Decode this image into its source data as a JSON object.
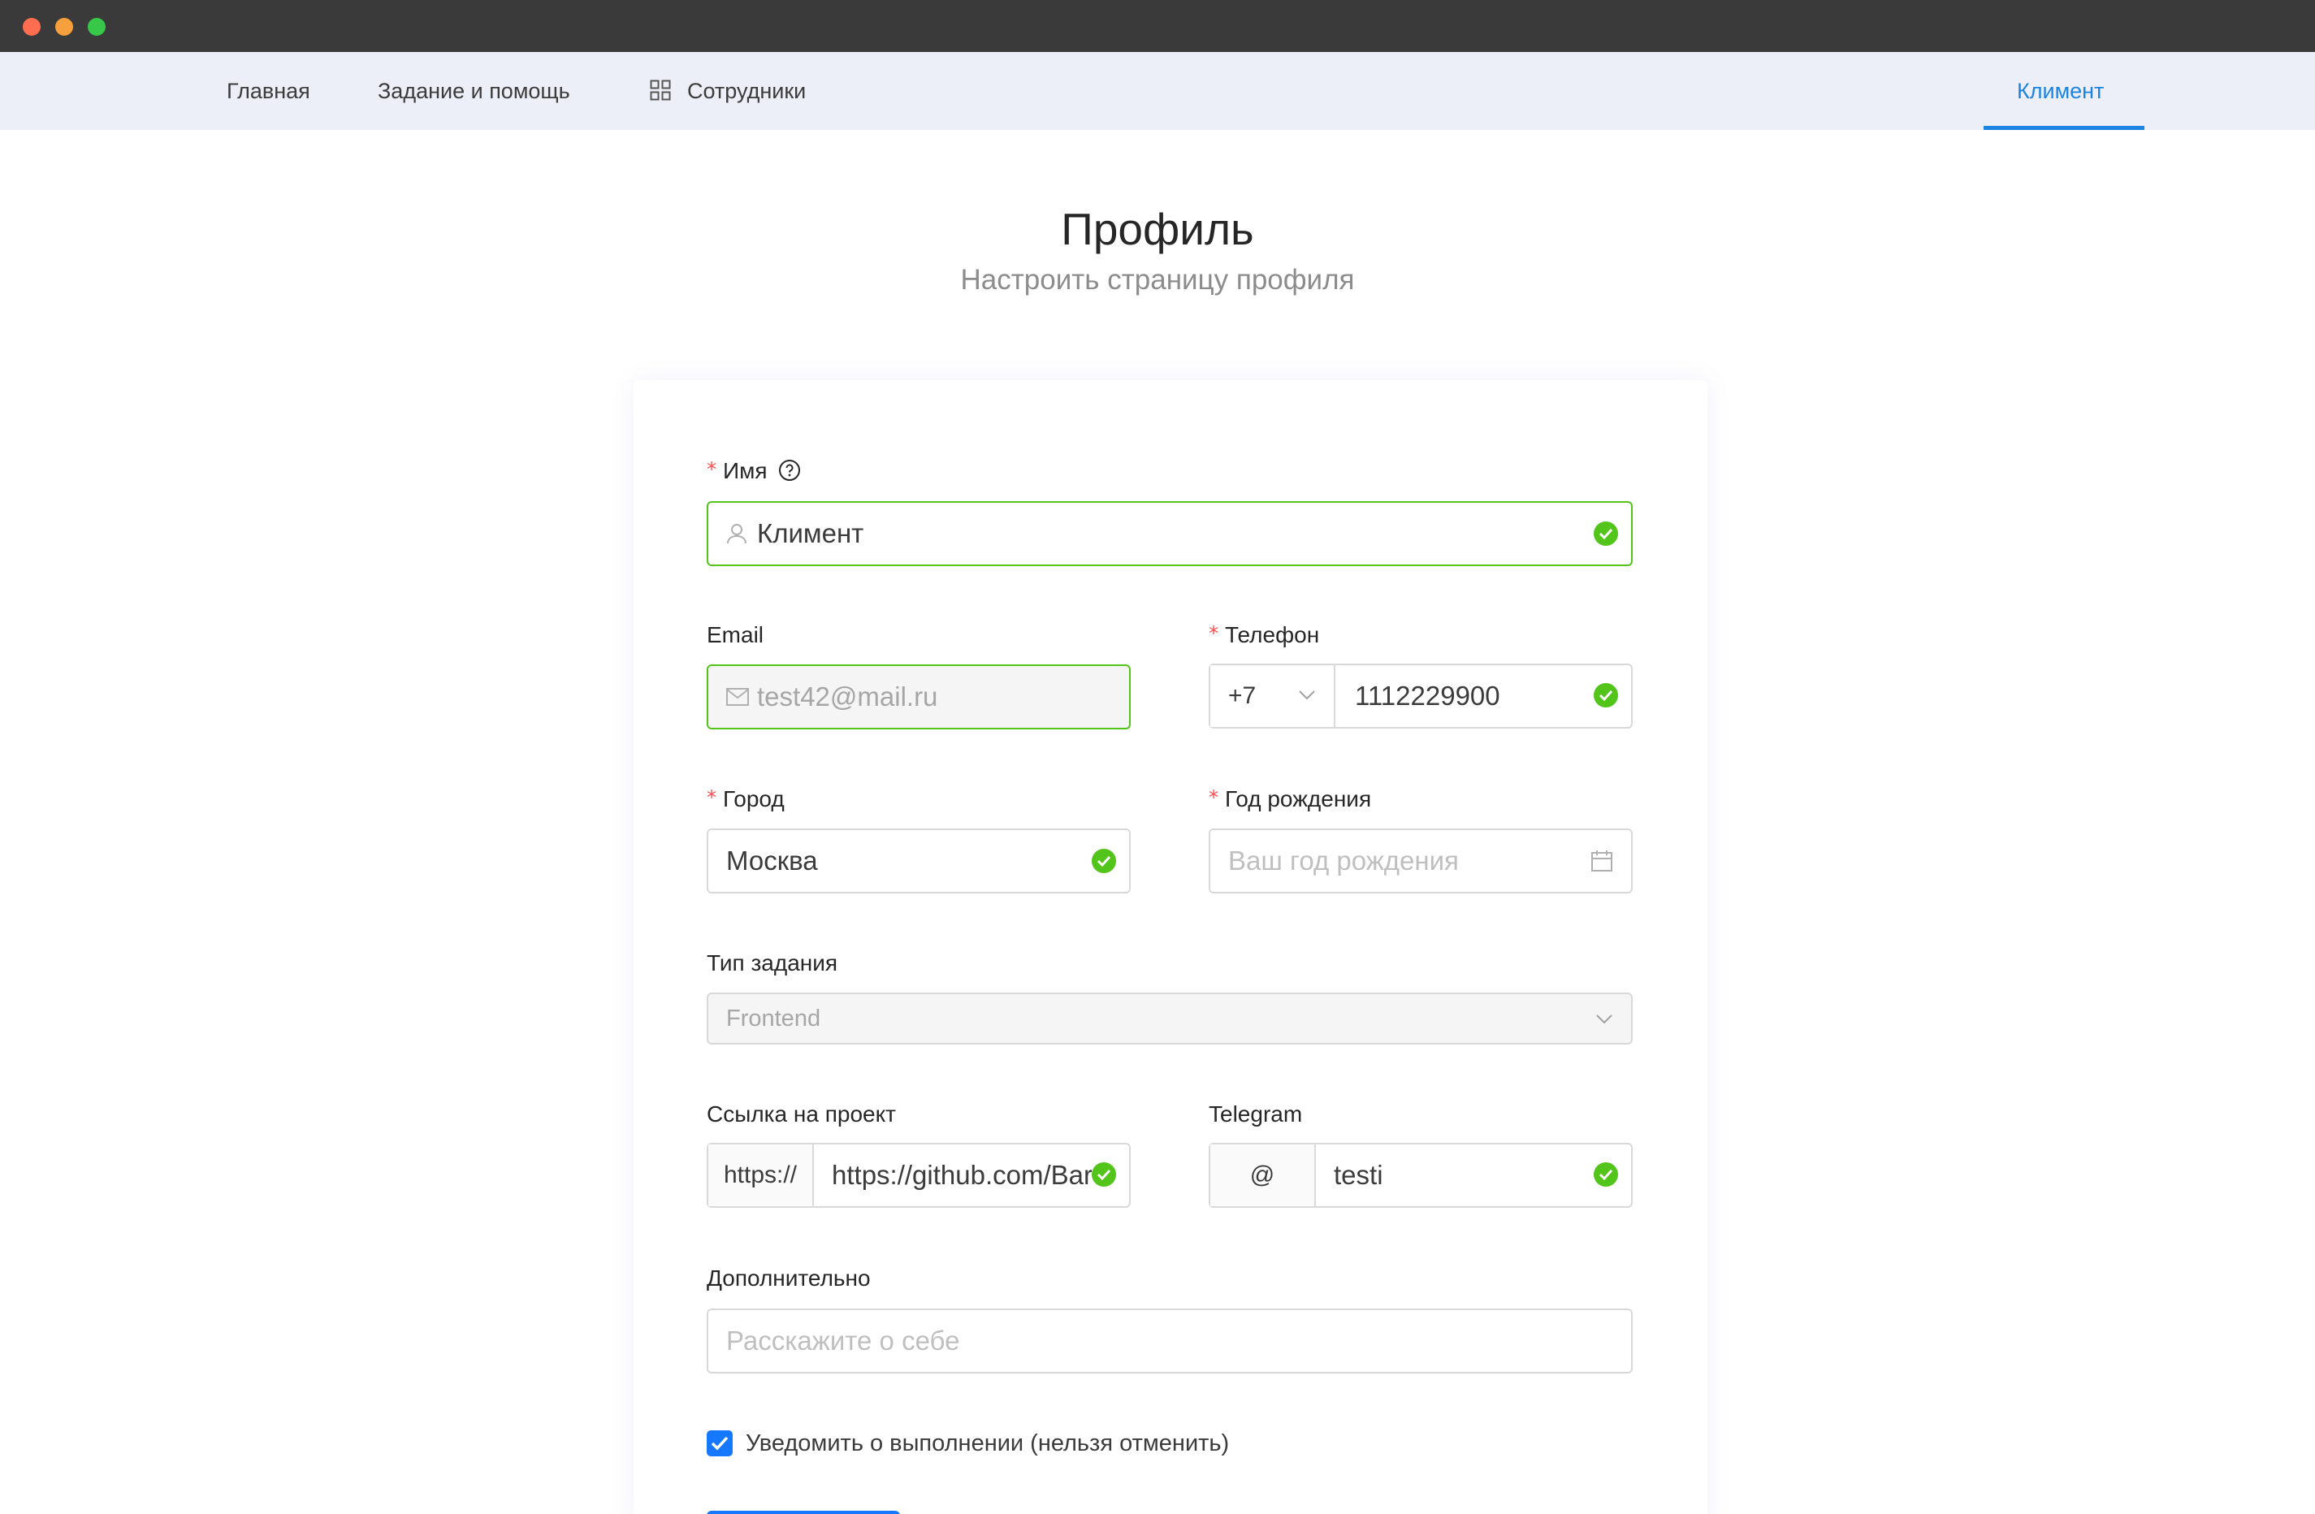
{
  "nav": {
    "items": [
      {
        "label": "Главная"
      },
      {
        "label": "Задание и помощь"
      },
      {
        "label": "Сотрудники"
      }
    ],
    "user": "Климент"
  },
  "header": {
    "title": "Профиль",
    "subtitle": "Настроить страницу профиля"
  },
  "form": {
    "name": {
      "label": "Имя",
      "required": true,
      "value": "Климент",
      "icon": "user-icon",
      "status": "success"
    },
    "email": {
      "label": "Email",
      "value": "test42@mail.ru",
      "icon": "mail-icon",
      "disabled": true
    },
    "phone": {
      "label": "Телефон",
      "required": true,
      "prefix": "+7",
      "value": "1112229900",
      "status": "success"
    },
    "city": {
      "label": "Город",
      "required": true,
      "value": "Москва",
      "status": "success"
    },
    "birth_year": {
      "label": "Год рождения",
      "required": true,
      "placeholder": "Ваш год рождения",
      "icon": "calendar-icon"
    },
    "task_type": {
      "label": "Тип задания",
      "value": "Frontend",
      "disabled": true
    },
    "project_link": {
      "label": "Ссылка на проект",
      "addon": "https://",
      "value": "https://github.com/Bar",
      "status": "success"
    },
    "telegram": {
      "label": "Telegram",
      "addon": "@",
      "value": "testi",
      "status": "success"
    },
    "extra": {
      "label": "Дополнительно",
      "placeholder": "Расскажите о себе"
    },
    "notify": {
      "label": "Уведомить о выполнении (нельзя отменить)",
      "checked": true
    }
  },
  "colors": {
    "accent": "#1a84e0",
    "success": "#52c41a",
    "required": "#ff4d4f",
    "nav_bg": "#eceef8"
  }
}
